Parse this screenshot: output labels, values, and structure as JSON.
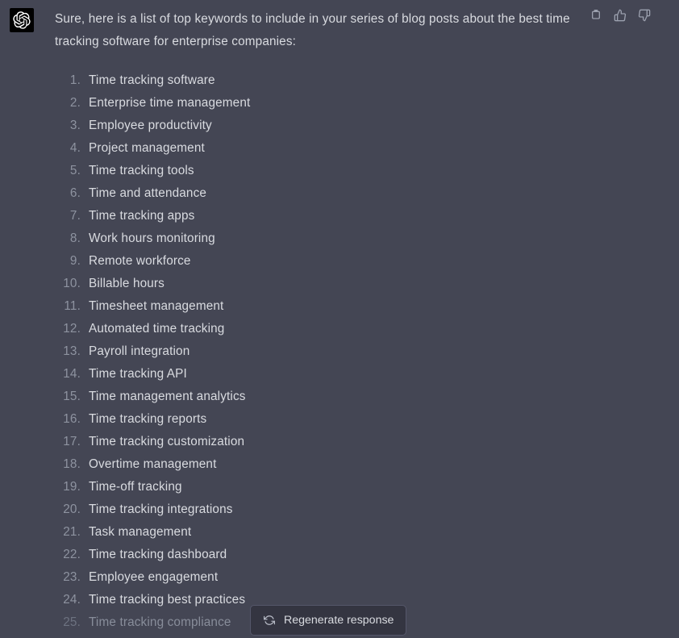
{
  "theme": {
    "background": "#444654",
    "text_primary": "#d9dbe0",
    "text_muted": "#8e93a0",
    "button_bg": "#343541",
    "button_border": "#55576a",
    "avatar_bg": "#000000"
  },
  "message": {
    "author": "assistant",
    "avatar_icon": "openai-logo-icon",
    "intro_paragraph": "Sure, here is a list of top keywords to include in your series of blog posts about the best time tracking software for enterprise companies:",
    "keywords": [
      "Time tracking software",
      "Enterprise time management",
      "Employee productivity",
      "Project management",
      "Time tracking tools",
      "Time and attendance",
      "Time tracking apps",
      "Work hours monitoring",
      "Remote workforce",
      "Billable hours",
      "Timesheet management",
      "Automated time tracking",
      "Payroll integration",
      "Time tracking API",
      "Time management analytics",
      "Time tracking reports",
      "Time tracking customization",
      "Overtime management",
      "Time-off tracking",
      "Time tracking integrations",
      "Task management",
      "Time tracking dashboard",
      "Employee engagement",
      "Time tracking best practices",
      "Time tracking compliance"
    ]
  },
  "actions": {
    "copy": {
      "icon": "clipboard-icon",
      "label": "Copy"
    },
    "thumbs_up": {
      "icon": "thumbs-up-icon",
      "label": "Good response"
    },
    "thumbs_down": {
      "icon": "thumbs-down-icon",
      "label": "Bad response"
    }
  },
  "regenerate": {
    "icon": "refresh-icon",
    "label": "Regenerate response"
  }
}
